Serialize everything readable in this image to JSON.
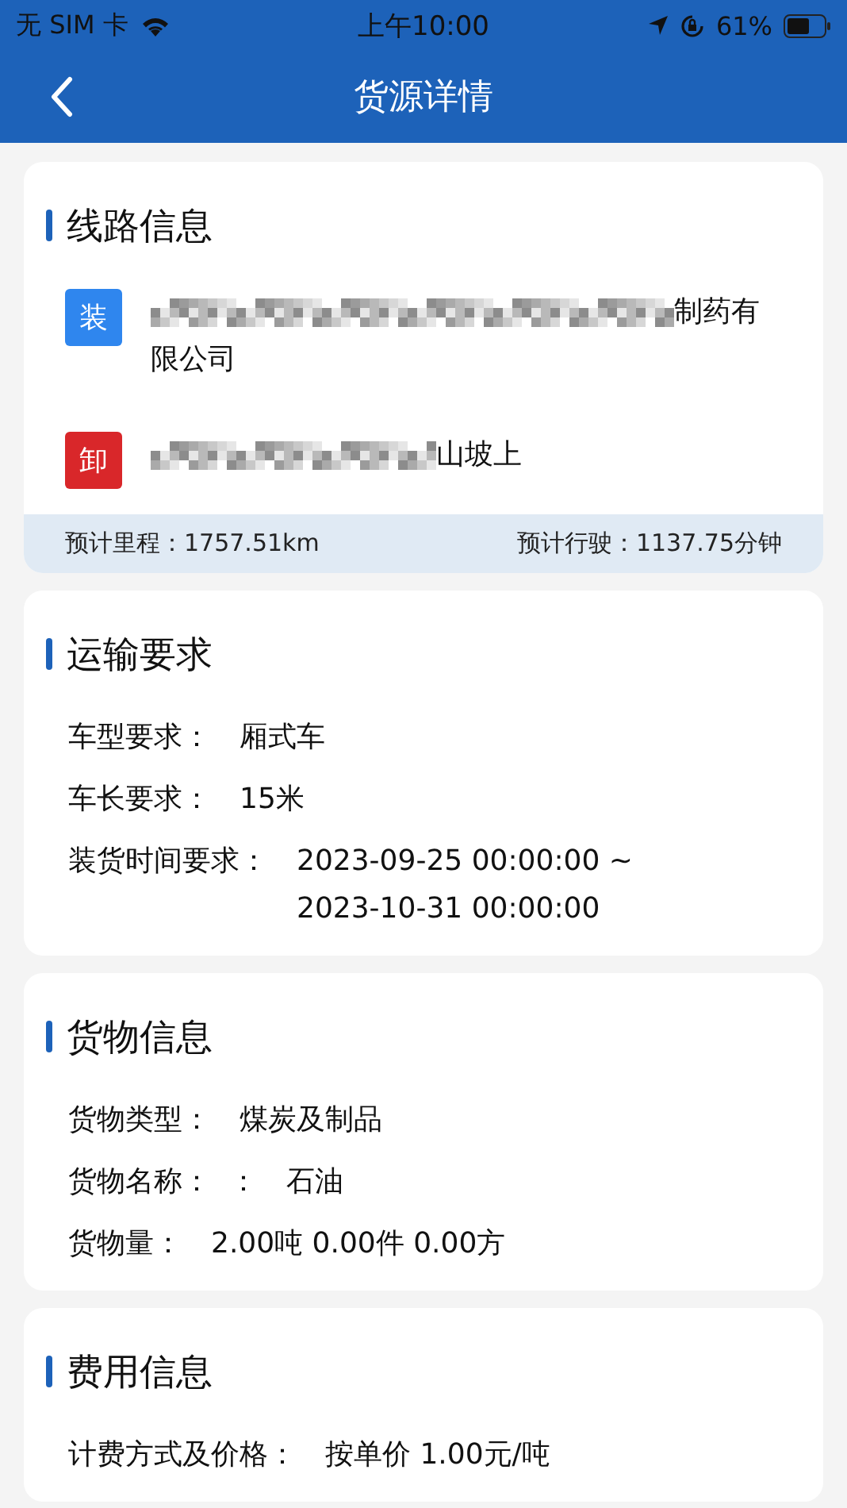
{
  "status_bar": {
    "carrier": "无 SIM 卡",
    "time": "上午10:00",
    "battery": "61%"
  },
  "nav": {
    "title": "货源详情"
  },
  "route": {
    "title": "线路信息",
    "stops": [
      {
        "kind": "load",
        "badge": "装",
        "redacted": true,
        "address_lines": [
          "制药有",
          "限公司"
        ]
      },
      {
        "kind": "unload",
        "badge": "卸",
        "redacted": true,
        "address_lines": [
          "山坡上"
        ]
      }
    ],
    "distance": "预计里程：1757.51km",
    "duration": "预计行驶：1137.75分钟"
  },
  "sections": [
    {
      "title": "运输要求",
      "rows": [
        {
          "label": "车型要求：",
          "values": [
            "厢式车"
          ]
        },
        {
          "label": "车长要求：",
          "values": [
            "15米"
          ]
        },
        {
          "label": "装货时间要求：",
          "values": [
            "2023-09-25 00:00:00 ~",
            "2023-10-31 00:00:00"
          ]
        }
      ]
    },
    {
      "title": "货物信息",
      "rows": [
        {
          "label": "货物类型：",
          "values": [
            "煤炭及制品"
          ]
        },
        {
          "label": "货物名称：  ：",
          "values": [
            "石油"
          ]
        },
        {
          "label": "货物量：",
          "values": [
            "2.00吨 0.00件 0.00方"
          ]
        }
      ]
    },
    {
      "title": "费用信息",
      "rows": [
        {
          "label": "计费方式及价格：",
          "values": [
            "按单价 1.00元/吨"
          ]
        }
      ]
    }
  ]
}
